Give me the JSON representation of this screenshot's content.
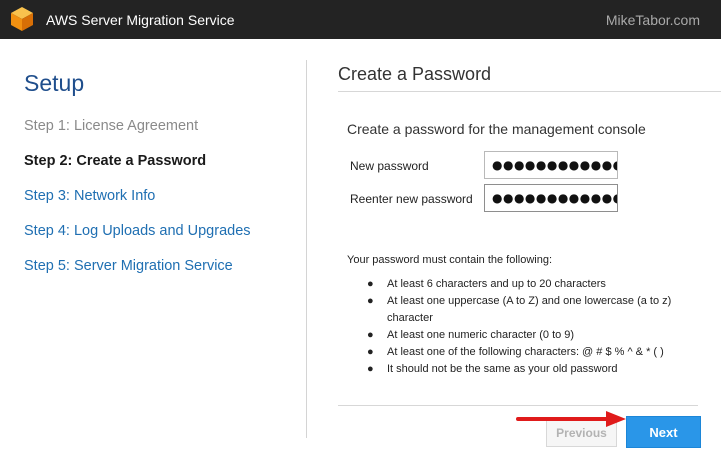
{
  "header": {
    "app_title": "AWS Server Migration Service",
    "watermark": "MikeTabor.com",
    "logo_icon": "aws-cube-icon",
    "logo_color": "#f7a81b",
    "background": "#232323"
  },
  "sidebar": {
    "title": "Setup",
    "steps": [
      {
        "label": "Step 1: License Agreement",
        "state": "done"
      },
      {
        "label": "Step 2: Create a Password",
        "state": "current"
      },
      {
        "label": "Step 3: Network Info",
        "state": "pending"
      },
      {
        "label": "Step 4: Log Uploads and Upgrades",
        "state": "pending"
      },
      {
        "label": "Step 5: Server Migration Service",
        "state": "pending"
      }
    ]
  },
  "main": {
    "title": "Create a Password",
    "subtitle": "Create a password for the management console",
    "fields": [
      {
        "label": "New password",
        "value": "●●●●●●●●●●●●●●"
      },
      {
        "label": "Reenter new password",
        "value": "●●●●●●●●●●●●●●"
      }
    ],
    "requirements_intro": "Your password must contain the following:",
    "requirements": [
      "At least 6 characters and up to 20 characters",
      "At least one uppercase (A to Z) and one lowercase (a to z) character",
      "At least one numeric character (0 to 9)",
      "At least one of the following characters: @ # $ % ^ & * ( )",
      "It should not be the same as your old password"
    ],
    "bullet": "●"
  },
  "buttons": {
    "previous_label": "Previous",
    "next_label": "Next",
    "next_color": "#2a96e8"
  },
  "annotation": {
    "arrow_color": "#e01b1b",
    "arrow_icon": "red-arrow-icon"
  }
}
